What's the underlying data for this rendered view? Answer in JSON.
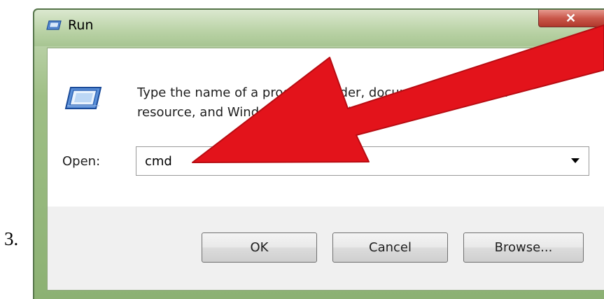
{
  "step_number": "3.",
  "window": {
    "title": "Run",
    "title_icon": "run-icon",
    "close_label": "✕"
  },
  "dialog": {
    "icon": "run-program-icon",
    "description_line1": "Type the name of a program, folder, document, or Internet",
    "description_line2": "resource, and Windows will open it for you.",
    "open_label": "Open:",
    "open_value": "cmd",
    "dropdown_icon": "chevron-down-icon"
  },
  "buttons": {
    "ok": "OK",
    "cancel": "Cancel",
    "browse": "Browse..."
  },
  "annotation": {
    "arrow_icon": "red-arrow-icon",
    "arrow_color": "#e3131b"
  }
}
